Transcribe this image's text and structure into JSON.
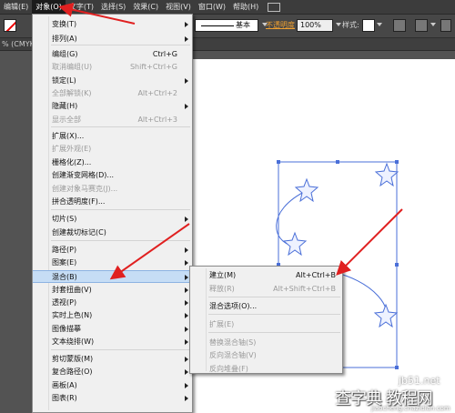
{
  "menubar": {
    "items": [
      "编辑(E)",
      "对象(O)",
      "文字(T)",
      "选择(S)",
      "效果(C)",
      "视图(V)",
      "窗口(W)",
      "帮助(H)"
    ]
  },
  "controlbar": {
    "stroke_style": "基本",
    "opacity_label": "不透明度",
    "opacity_value": "100%",
    "style_label": "样式:"
  },
  "doc_tab": {
    "label": "% (CMYK"
  },
  "object_menu": {
    "items": [
      {
        "label": "变换(T)",
        "shortcut": "",
        "submenu": true,
        "disabled": false
      },
      {
        "label": "排列(A)",
        "shortcut": "",
        "submenu": true,
        "disabled": false
      },
      {
        "label": "编组(G)",
        "shortcut": "Ctrl+G",
        "submenu": false,
        "disabled": false
      },
      {
        "label": "取消编组(U)",
        "shortcut": "Shift+Ctrl+G",
        "submenu": false,
        "disabled": true
      },
      {
        "label": "锁定(L)",
        "shortcut": "",
        "submenu": true,
        "disabled": false
      },
      {
        "label": "全部解锁(K)",
        "shortcut": "Alt+Ctrl+2",
        "submenu": false,
        "disabled": true
      },
      {
        "label": "隐藏(H)",
        "shortcut": "",
        "submenu": true,
        "disabled": false
      },
      {
        "label": "显示全部",
        "shortcut": "Alt+Ctrl+3",
        "submenu": false,
        "disabled": true
      },
      {
        "label": "扩展(X)...",
        "shortcut": "",
        "submenu": false,
        "disabled": false
      },
      {
        "label": "扩展外观(E)",
        "shortcut": "",
        "submenu": false,
        "disabled": true
      },
      {
        "label": "栅格化(Z)...",
        "shortcut": "",
        "submenu": false,
        "disabled": false
      },
      {
        "label": "创建渐变网格(D)...",
        "shortcut": "",
        "submenu": false,
        "disabled": false
      },
      {
        "label": "创建对象马赛克(J)...",
        "shortcut": "",
        "submenu": false,
        "disabled": true
      },
      {
        "label": "拼合透明度(F)...",
        "shortcut": "",
        "submenu": false,
        "disabled": false
      },
      {
        "label": "切片(S)",
        "shortcut": "",
        "submenu": true,
        "disabled": false
      },
      {
        "label": "创建裁切标记(C)",
        "shortcut": "",
        "submenu": false,
        "disabled": false
      },
      {
        "label": "路径(P)",
        "shortcut": "",
        "submenu": true,
        "disabled": false
      },
      {
        "label": "图案(E)",
        "shortcut": "",
        "submenu": true,
        "disabled": false
      },
      {
        "label": "混合(B)",
        "shortcut": "",
        "submenu": true,
        "disabled": false,
        "highlighted": true
      },
      {
        "label": "封套扭曲(V)",
        "shortcut": "",
        "submenu": true,
        "disabled": false
      },
      {
        "label": "透视(P)",
        "shortcut": "",
        "submenu": true,
        "disabled": false
      },
      {
        "label": "实时上色(N)",
        "shortcut": "",
        "submenu": true,
        "disabled": false
      },
      {
        "label": "图像描摹",
        "shortcut": "",
        "submenu": true,
        "disabled": false
      },
      {
        "label": "文本绕排(W)",
        "shortcut": "",
        "submenu": true,
        "disabled": false
      },
      {
        "label": "剪切蒙版(M)",
        "shortcut": "",
        "submenu": true,
        "disabled": false
      },
      {
        "label": "复合路径(O)",
        "shortcut": "",
        "submenu": true,
        "disabled": false
      },
      {
        "label": "画板(A)",
        "shortcut": "",
        "submenu": true,
        "disabled": false
      },
      {
        "label": "图表(R)",
        "shortcut": "",
        "submenu": true,
        "disabled": false
      }
    ]
  },
  "blend_submenu": {
    "items": [
      {
        "label": "建立(M)",
        "shortcut": "Alt+Ctrl+B",
        "disabled": false
      },
      {
        "label": "释放(R)",
        "shortcut": "Alt+Shift+Ctrl+B",
        "disabled": true
      },
      {
        "label": "混合选项(O)...",
        "shortcut": "",
        "disabled": false
      },
      {
        "label": "扩展(E)",
        "shortcut": "",
        "disabled": true
      },
      {
        "label": "替换混合轴(S)",
        "shortcut": "",
        "disabled": true
      },
      {
        "label": "反向混合轴(V)",
        "shortcut": "",
        "disabled": true
      },
      {
        "label": "反向堆叠(F)",
        "shortcut": "",
        "disabled": true
      }
    ]
  },
  "watermark": {
    "line1": "jb51.net",
    "line2": "查字典 教程网",
    "line3": "jiaocheng.chazidian.com"
  },
  "colors": {
    "menu_highlight": "#c6ddf5",
    "annotation_arrow": "#e02020",
    "selection_blue": "#4a6fd8"
  }
}
